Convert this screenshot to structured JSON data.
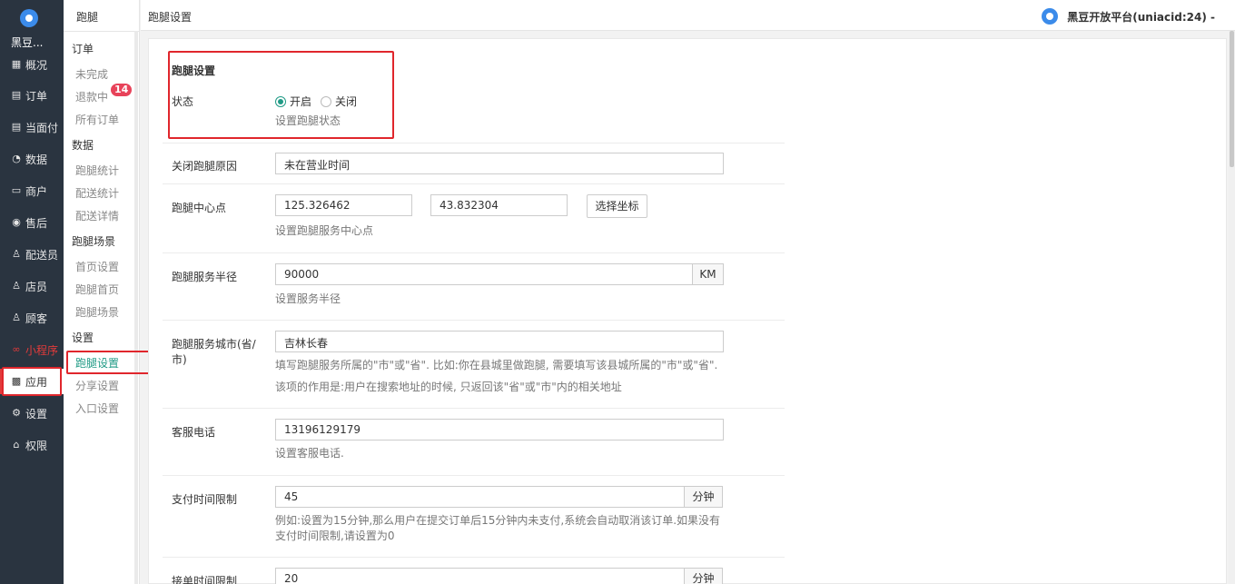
{
  "sidebar": {
    "brand": "黑豆...",
    "items": [
      {
        "label": "概况",
        "icon": "▦"
      },
      {
        "label": "订单",
        "icon": "▤"
      },
      {
        "label": "当面付",
        "icon": "▤"
      },
      {
        "label": "数据",
        "icon": "◔"
      },
      {
        "label": "商户",
        "icon": "▭"
      },
      {
        "label": "售后",
        "icon": "◉"
      },
      {
        "label": "配送员",
        "icon": "♙"
      },
      {
        "label": "店员",
        "icon": "♙"
      },
      {
        "label": "顾客",
        "icon": "♙"
      },
      {
        "label": "小程序",
        "icon": "∞"
      },
      {
        "label": "应用",
        "icon": "▩"
      },
      {
        "label": "设置",
        "icon": "⚙"
      },
      {
        "label": "权限",
        "icon": "⌂"
      }
    ]
  },
  "submenu": {
    "title": "跑腿",
    "groups": {
      "order": "订单",
      "data": "数据",
      "scene": "跑腿场景",
      "settings": "设置"
    },
    "links": {
      "unfinished": "未完成",
      "refund": "退款中",
      "refund_badge": "14",
      "all_orders": "所有订单",
      "errand_stats": "跑腿统计",
      "delivery_stats": "配送统计",
      "delivery_detail": "配送详情",
      "home_settings": "首页设置",
      "errand_home": "跑腿首页",
      "errand_scene": "跑腿场景",
      "errand_settings": "跑腿设置",
      "share_settings": "分享设置",
      "entry_settings": "入口设置"
    }
  },
  "topbar": {
    "breadcrumb": "跑腿设置",
    "account": "黑豆开放平台(uniacid:24) -"
  },
  "form": {
    "section_title": "跑腿设置",
    "status": {
      "label": "状态",
      "options": [
        "开启",
        "关闭"
      ],
      "selected": "开启",
      "hint": "设置跑腿状态"
    },
    "close_reason": {
      "label": "关闭跑腿原因",
      "value": "未在营业时间"
    },
    "center": {
      "label": "跑腿中心点",
      "lng": "125.326462",
      "lat": "43.832304",
      "button": "选择坐标",
      "hint": "设置跑腿服务中心点"
    },
    "radius": {
      "label": "跑腿服务半径",
      "value": "90000",
      "unit": "KM",
      "hint": "设置服务半径"
    },
    "city": {
      "label_line1": "跑腿服务城市(省/",
      "label_line2": "市)",
      "value": "吉林长春",
      "hint1": "填写跑腿服务所属的\"市\"或\"省\". 比如:你在县城里做跑腿, 需要填写该县城所属的\"市\"或\"省\".",
      "hint2": "该项的作用是:用户在搜索地址的时候, 只返回该\"省\"或\"市\"内的相关地址"
    },
    "phone": {
      "label": "客服电话",
      "value": "13196129179",
      "hint": "设置客服电话."
    },
    "pay_limit": {
      "label": "支付时间限制",
      "value": "45",
      "unit": "分钟",
      "hint1": "例如:设置为15分钟,那么用户在提交订单后15分钟内未支付,系统会自动取消该订单.如果没有",
      "hint2": "支付时间限制,请设置为0"
    },
    "accept_limit": {
      "label": "接单时间限制",
      "value": "20",
      "unit": "分钟"
    }
  },
  "colors": {
    "sidebar_bg": "#2a3440",
    "accent": "#1f9a85",
    "highlight_red": "#e0262c",
    "badge": "#e8435a"
  }
}
